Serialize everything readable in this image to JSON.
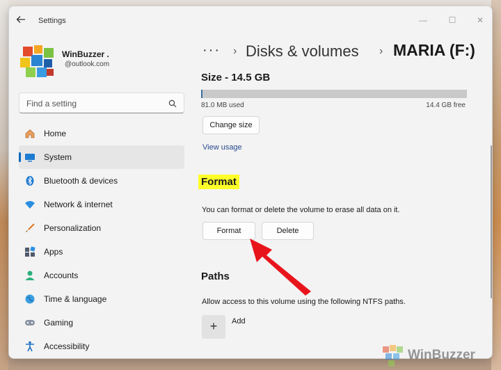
{
  "window": {
    "app_title": "Settings",
    "controls": {
      "minimize": "—",
      "maximize": "☐",
      "close": "✕"
    }
  },
  "user": {
    "name": "WinBuzzer .",
    "email": "@outlook.com"
  },
  "search": {
    "placeholder": "Find a setting"
  },
  "sidebar": {
    "items": [
      {
        "label": "Home",
        "icon": "home-icon",
        "active": false
      },
      {
        "label": "System",
        "icon": "system-icon",
        "active": true
      },
      {
        "label": "Bluetooth & devices",
        "icon": "bluetooth-icon",
        "active": false
      },
      {
        "label": "Network & internet",
        "icon": "wifi-icon",
        "active": false
      },
      {
        "label": "Personalization",
        "icon": "brush-icon",
        "active": false
      },
      {
        "label": "Apps",
        "icon": "apps-icon",
        "active": false
      },
      {
        "label": "Accounts",
        "icon": "accounts-icon",
        "active": false
      },
      {
        "label": "Time & language",
        "icon": "globe-icon",
        "active": false
      },
      {
        "label": "Gaming",
        "icon": "gamepad-icon",
        "active": false
      },
      {
        "label": "Accessibility",
        "icon": "accessibility-icon",
        "active": false
      }
    ]
  },
  "breadcrumb": {
    "dots": "···",
    "parent": "Disks & volumes",
    "current": "MARIA (F:)"
  },
  "size": {
    "title": "Size - 14.5 GB",
    "used": "81.0 MB used",
    "free": "14.4 GB free",
    "used_fraction": 0.0056,
    "change_label": "Change size",
    "view_usage": "View usage"
  },
  "format": {
    "title": "Format",
    "description": "You can format or delete the volume to erase all data on it.",
    "format_label": "Format",
    "delete_label": "Delete"
  },
  "paths": {
    "title": "Paths",
    "description": "Allow access to this volume using the following NTFS paths.",
    "add_label": "Add",
    "add_symbol": "+"
  },
  "watermark": {
    "text": "WinBuzzer"
  },
  "colors": {
    "accent": "#0067c0",
    "highlight": "#ffff2a",
    "arrow": "#e8141c"
  }
}
